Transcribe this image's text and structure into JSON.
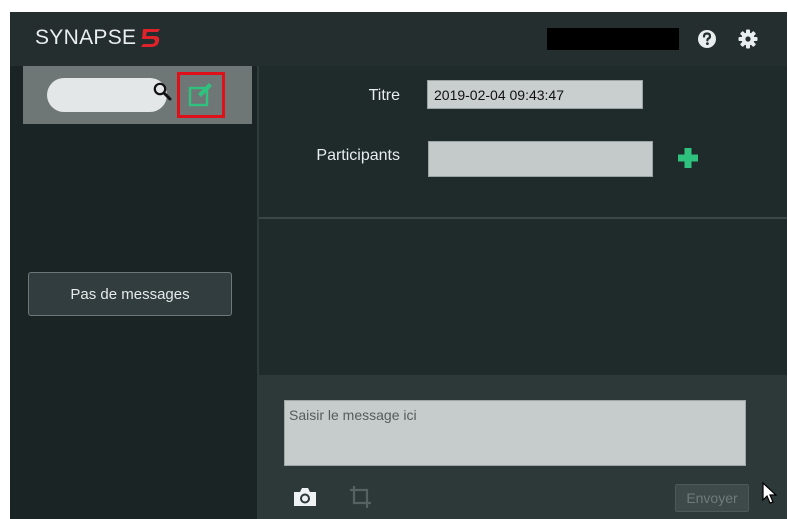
{
  "header": {
    "logo_text": "SYNAPSE",
    "logo_mark": "5",
    "user_name": "",
    "help_icon": "question-circle-icon",
    "settings_icon": "gear-icon"
  },
  "sidebar": {
    "search": {
      "placeholder": "",
      "value": "",
      "icon": "search-icon"
    },
    "compose_icon": "edit-icon",
    "no_messages_label": "Pas de messages"
  },
  "main": {
    "title_label": "Titre",
    "title_value": "2019-02-04 09:43:47",
    "participants_label": "Participants",
    "participants_value": "",
    "add_participant_icon": "plus-icon",
    "composer": {
      "placeholder": "Saisir le message ici",
      "camera_icon": "camera-icon",
      "crop_icon": "crop-icon",
      "send_label": "Envoyer"
    }
  },
  "colors": {
    "app_background": "#1f2a2b",
    "header": "#242e2f",
    "accent_green": "#2ec27e",
    "logo_red": "#e0222a",
    "highlight_red": "#e0101a"
  }
}
